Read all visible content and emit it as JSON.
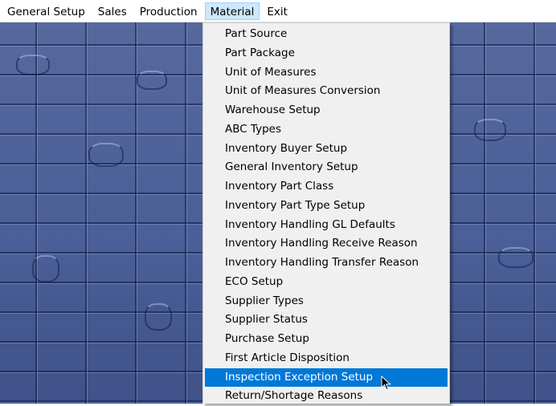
{
  "menubar": {
    "items": [
      {
        "label": "General Setup"
      },
      {
        "label": "Sales"
      },
      {
        "label": "Production"
      },
      {
        "label": "Material"
      },
      {
        "label": "Exit"
      }
    ]
  },
  "material_menu": {
    "items": [
      {
        "label": "Part Source"
      },
      {
        "label": "Part Package"
      },
      {
        "label": "Unit of Measures"
      },
      {
        "label": "Unit of Measures Conversion"
      },
      {
        "label": "Warehouse Setup"
      },
      {
        "label": "ABC Types"
      },
      {
        "label": "Inventory Buyer Setup"
      },
      {
        "label": "General Inventory Setup"
      },
      {
        "label": "Inventory Part Class"
      },
      {
        "label": "Inventory Part Type Setup"
      },
      {
        "label": "Inventory Handling GL Defaults"
      },
      {
        "label": "Inventory Handling Receive Reason"
      },
      {
        "label": "Inventory Handling Transfer Reason"
      },
      {
        "label": "ECO Setup"
      },
      {
        "label": "Supplier Types"
      },
      {
        "label": "Supplier Status"
      },
      {
        "label": "Purchase Setup"
      },
      {
        "label": "First Article Disposition"
      },
      {
        "label": "Inspection Exception Setup"
      },
      {
        "label": "Return/Shortage Reasons"
      }
    ],
    "selected_label": "Inspection Exception Setup"
  },
  "colors": {
    "menubar_open_bg": "#cce8ff",
    "selection_bg": "#0078d7",
    "menu_bg": "#f0f0f0",
    "background": "#4a5f99"
  },
  "icons": {
    "cursor": "mouse-pointer-icon"
  }
}
